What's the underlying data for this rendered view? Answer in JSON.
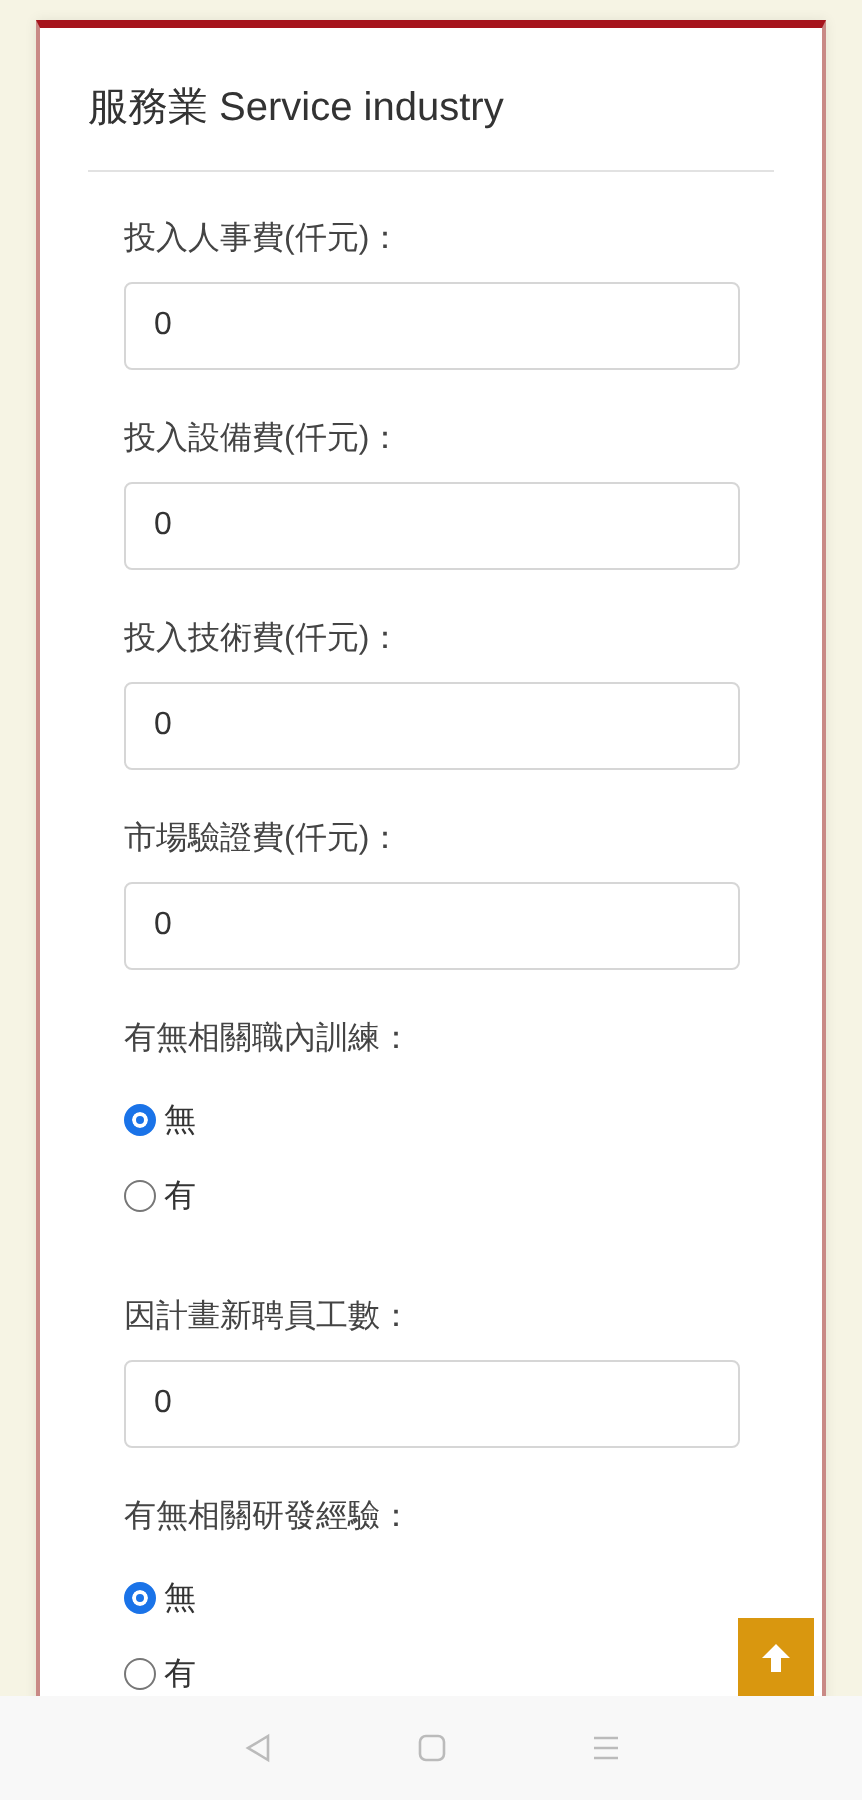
{
  "card": {
    "title": "服務業 Service industry"
  },
  "fields": [
    {
      "kind": "input",
      "label": "投入人事費(仟元)：",
      "value": "0"
    },
    {
      "kind": "input",
      "label": "投入設備費(仟元)：",
      "value": "0"
    },
    {
      "kind": "input",
      "label": "投入技術費(仟元)：",
      "value": "0"
    },
    {
      "kind": "input",
      "label": "市場驗證費(仟元)：",
      "value": "0"
    },
    {
      "kind": "radio",
      "label": "有無相關職內訓練：",
      "options": [
        {
          "label": "無",
          "selected": true
        },
        {
          "label": "有",
          "selected": false
        }
      ]
    },
    {
      "kind": "input",
      "label": "因計畫新聘員工數：",
      "value": "0"
    },
    {
      "kind": "radio",
      "label": "有無相關研發經驗：",
      "options": [
        {
          "label": "無",
          "selected": true
        },
        {
          "label": "有",
          "selected": false
        }
      ]
    }
  ]
}
